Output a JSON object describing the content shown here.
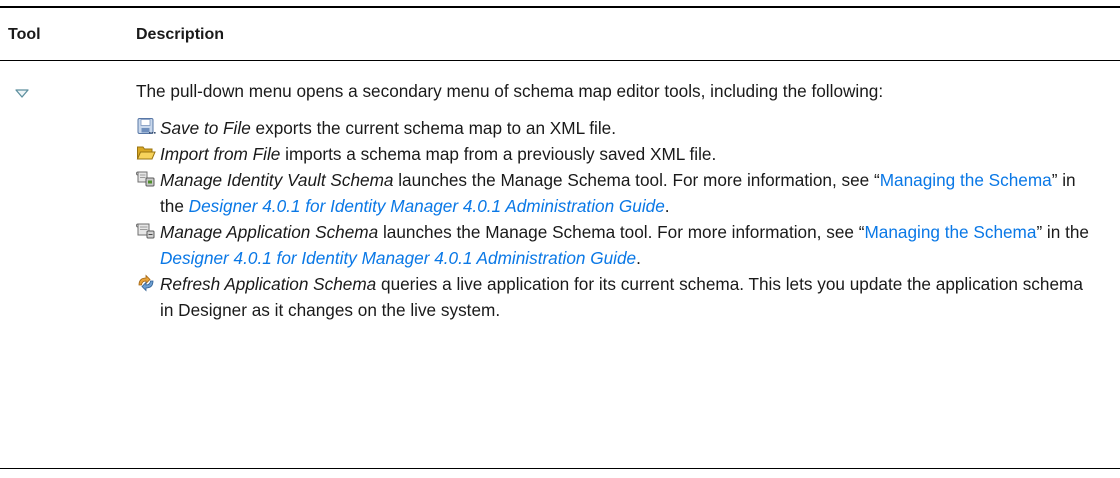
{
  "table": {
    "header": {
      "tool": "Tool",
      "description": "Description"
    },
    "row": {
      "tool_icon": "pull-down-triangle-icon",
      "intro": "The pull-down menu opens a secondary menu of schema map editor tools, including the following:",
      "items": [
        {
          "icon": "save-to-file-icon",
          "name": "Save to File",
          "text": " exports the current schema map to an XML file."
        },
        {
          "icon": "import-folder-icon",
          "name": "Import from File",
          "text": " imports a schema map from a previously saved XML file."
        },
        {
          "icon": "manage-vault-schema-icon",
          "name": "Manage Identity Vault Schema",
          "text": " launches the Manage Schema tool. For more information, see “",
          "link": "Managing the Schema",
          "mid": "” in the ",
          "guide": "Designer 4.0.1 for Identity Manager 4.0.1 Administration Guide",
          "end": "."
        },
        {
          "icon": "manage-application-schema-icon",
          "name": "Manage Application Schema",
          "text": " launches the Manage Schema tool. For more information, see “",
          "link": "Managing the Schema",
          "mid": "” in the ",
          "guide": "Designer 4.0.1 for Identity Manager 4.0.1 Administration Guide",
          "end": "."
        },
        {
          "icon": "refresh-schema-icon",
          "name": "Refresh Application Schema",
          "text": " queries a live application for its current schema. This lets you update the application schema in Designer as it changes on the live system."
        }
      ]
    }
  },
  "colors": {
    "link": "#0a78e6",
    "rule": "#000000"
  }
}
